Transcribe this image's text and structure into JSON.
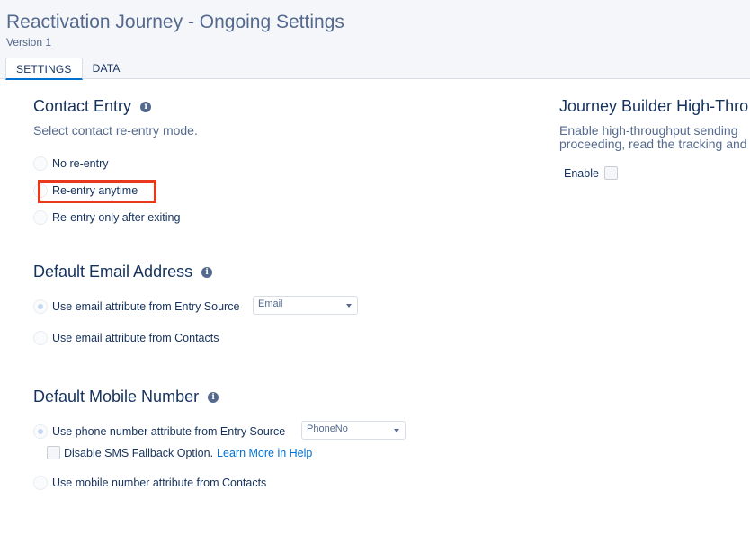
{
  "header": {
    "title": "Reactivation Journey - Ongoing Settings",
    "version": "Version 1",
    "tabs": [
      {
        "label": "SETTINGS",
        "active": true
      },
      {
        "label": "DATA",
        "active": false
      }
    ]
  },
  "contact_entry": {
    "title": "Contact Entry",
    "subtitle": "Select contact re-entry mode.",
    "options": [
      {
        "label": "No re-entry",
        "checked": false
      },
      {
        "label": "Re-entry anytime",
        "checked": false
      },
      {
        "label": "Re-entry only after exiting",
        "checked": false
      }
    ]
  },
  "default_email": {
    "title": "Default Email Address",
    "options": [
      {
        "label": "Use email attribute from Entry Source",
        "checked": true
      },
      {
        "label": "Use email attribute from Contacts",
        "checked": false
      }
    ],
    "select_value": "Email"
  },
  "default_mobile": {
    "title": "Default Mobile Number",
    "options": [
      {
        "label": "Use phone number attribute from Entry Source",
        "checked": true
      },
      {
        "label": "Use mobile number attribute from Contacts",
        "checked": false
      }
    ],
    "select_value": "PhoneNo",
    "sms_fallback_label": "Disable SMS Fallback Option.",
    "learn_more_label": "Learn More in Help"
  },
  "high_throughput": {
    "title": "Journey Builder High-Thro",
    "text_line1": "Enable high-throughput sending",
    "text_line2": "proceeding, read the tracking and",
    "enable_label": "Enable"
  },
  "colors": {
    "accent": "#0070d2",
    "highlight": "#e8391d",
    "text": "#16325c",
    "muted": "#54698d"
  },
  "icons": [
    "info-icon",
    "caret-down-icon"
  ]
}
